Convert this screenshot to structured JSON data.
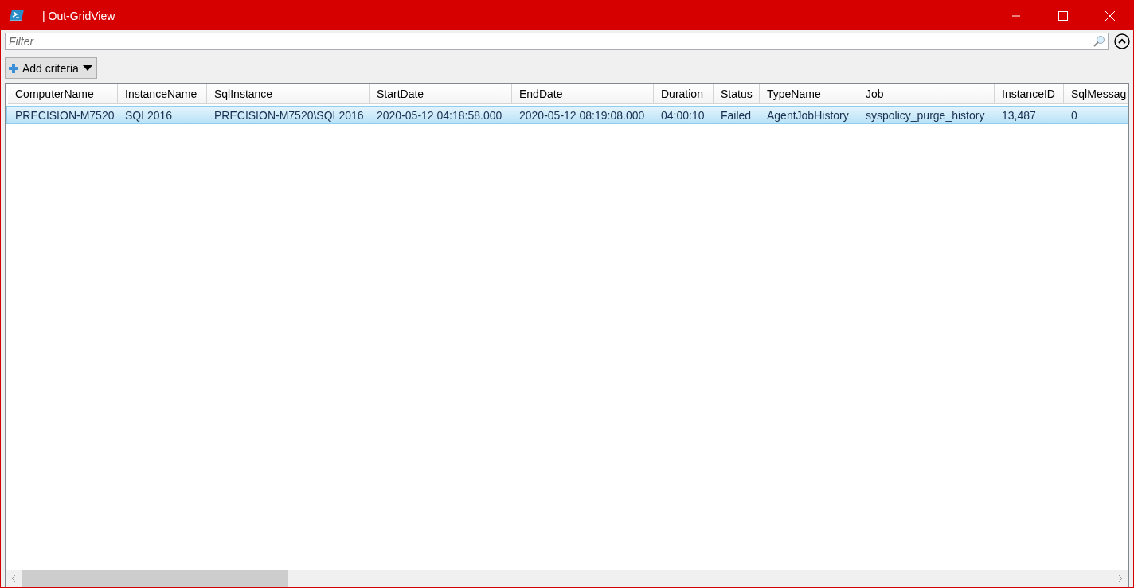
{
  "window": {
    "title": "| Out-GridView"
  },
  "filter": {
    "placeholder": "Filter"
  },
  "add_criteria": {
    "label": "Add criteria"
  },
  "table": {
    "columns": [
      "ComputerName",
      "InstanceName",
      "SqlInstance",
      "StartDate",
      "EndDate",
      "Duration",
      "Status",
      "TypeName",
      "Job",
      "InstanceID",
      "SqlMessag"
    ],
    "rows": [
      {
        "selected": true,
        "cells": [
          "PRECISION-M7520",
          "SQL2016",
          "PRECISION-M7520\\SQL2016",
          "2020-05-12 04:18:58.000",
          "2020-05-12 08:19:08.000",
          "04:00:10",
          "Failed",
          "AgentJobHistory",
          "syspolicy_purge_history",
          "13,487",
          "0"
        ]
      }
    ]
  }
}
